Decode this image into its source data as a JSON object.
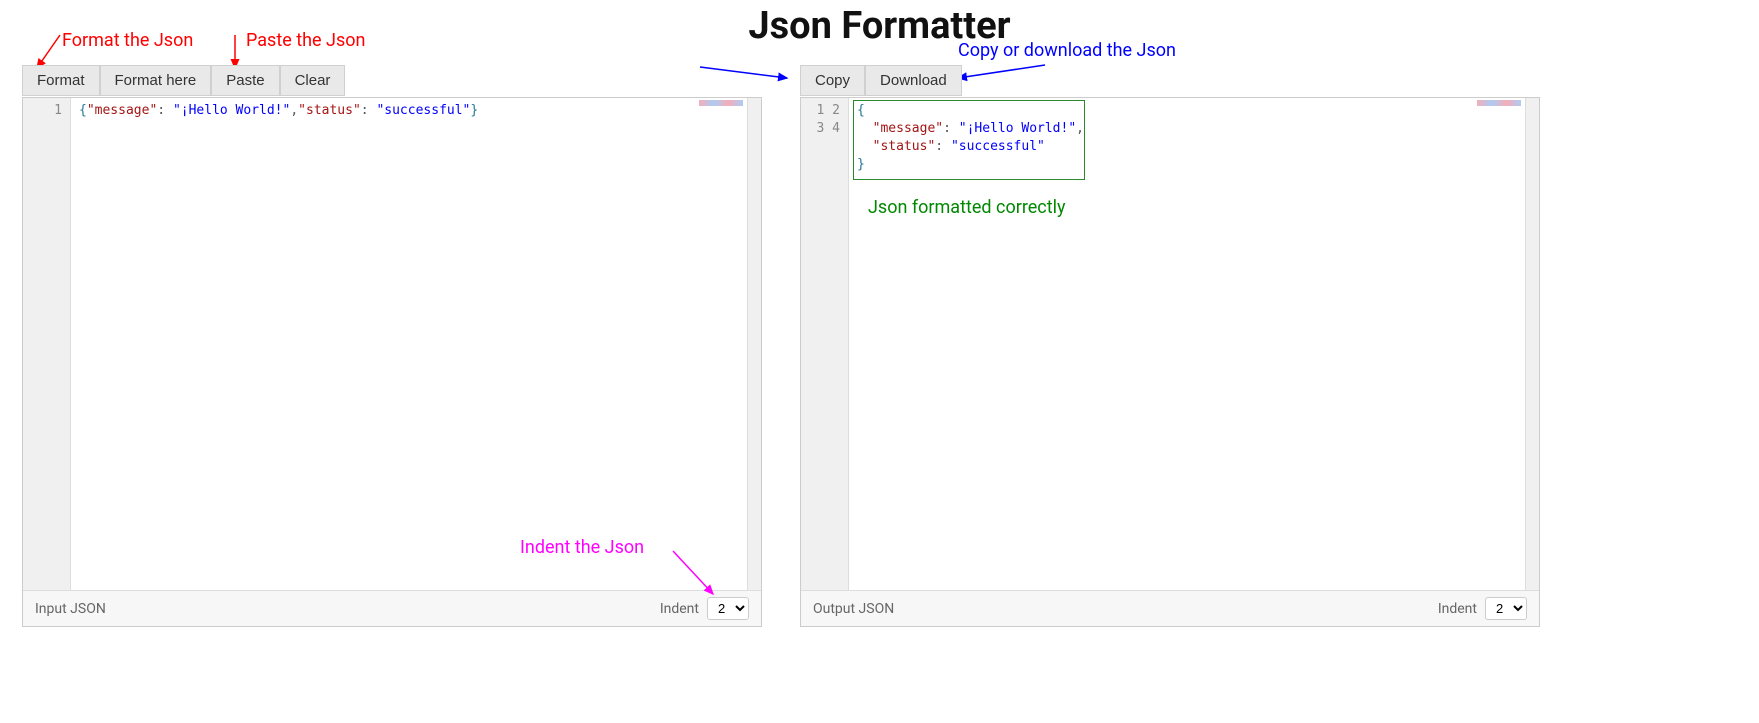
{
  "title": "Json Formatter",
  "annotations": {
    "format_the_json": "Format the Json",
    "paste_the_json": "Paste the Json",
    "copy_or_download": "Copy or download the Json",
    "formatted_ok": "Json formatted correctly",
    "indent_the_json": "Indent the Json"
  },
  "toolbar_left": {
    "format": "Format",
    "format_here": "Format here",
    "paste": "Paste",
    "clear": "Clear"
  },
  "toolbar_right": {
    "copy": "Copy",
    "download": "Download"
  },
  "input_editor": {
    "footer_label": "Input JSON",
    "indent_label": "Indent",
    "indent_value": "2",
    "line_numbers": [
      "1"
    ],
    "code_tokens": [
      [
        {
          "t": "{",
          "c": "brace"
        },
        {
          "t": "\"message\"",
          "c": "key"
        },
        {
          "t": ": ",
          "c": "punc"
        },
        {
          "t": "\"¡Hello World!\"",
          "c": "str"
        },
        {
          "t": ",",
          "c": "punc"
        },
        {
          "t": "\"status\"",
          "c": "key"
        },
        {
          "t": ": ",
          "c": "punc"
        },
        {
          "t": "\"successful\"",
          "c": "str"
        },
        {
          "t": "}",
          "c": "brace"
        }
      ]
    ]
  },
  "output_editor": {
    "footer_label": "Output JSON",
    "indent_label": "Indent",
    "indent_value": "2",
    "line_numbers": [
      "1",
      "2",
      "3",
      "4"
    ],
    "code_tokens": [
      [
        {
          "t": "{",
          "c": "brace"
        }
      ],
      [
        {
          "t": "  ",
          "c": "punc"
        },
        {
          "t": "\"message\"",
          "c": "key"
        },
        {
          "t": ": ",
          "c": "punc"
        },
        {
          "t": "\"¡Hello World!\"",
          "c": "str"
        },
        {
          "t": ",",
          "c": "punc"
        }
      ],
      [
        {
          "t": "  ",
          "c": "punc"
        },
        {
          "t": "\"status\"",
          "c": "key"
        },
        {
          "t": ": ",
          "c": "punc"
        },
        {
          "t": "\"successful\"",
          "c": "str"
        }
      ],
      [
        {
          "t": "}",
          "c": "brace"
        }
      ]
    ]
  }
}
